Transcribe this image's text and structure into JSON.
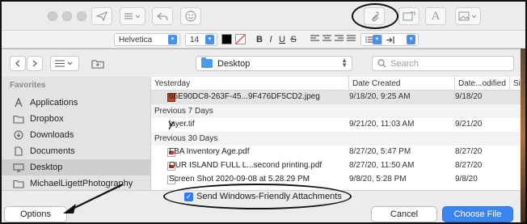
{
  "compose_toolbar": {
    "icons": [
      "send-icon",
      "list-dropdown-icon",
      "reply-icon",
      "emoji-icon",
      "attachment-paperclip-icon",
      "header-fields-icon",
      "format-text-icon",
      "photo-browser-icon"
    ],
    "format_label": "A"
  },
  "format_bar": {
    "font_family": "Helvetica",
    "font_size": "14",
    "bold": "B",
    "italic": "I",
    "underline": "U",
    "strike": "S",
    "text_color": "#000000"
  },
  "dialog": {
    "location": "Desktop",
    "search_placeholder": "Search"
  },
  "sidebar": {
    "heading": "Favorites",
    "items": [
      {
        "label": "Applications",
        "icon": "applications-icon"
      },
      {
        "label": "Dropbox",
        "icon": "dropbox-folder-icon"
      },
      {
        "label": "Downloads",
        "icon": "downloads-icon"
      },
      {
        "label": "Documents",
        "icon": "documents-icon"
      },
      {
        "label": "Desktop",
        "icon": "desktop-icon",
        "selected": true
      },
      {
        "label": "MichaelLigettPhotography",
        "icon": "folder-icon"
      }
    ]
  },
  "filelist": {
    "columns": {
      "name": "Yesterday",
      "created": "Date Created",
      "modified": "Date...odified",
      "size": "Siz"
    },
    "groups": [
      {
        "label": "Yesterday",
        "rows": [
          {
            "name": "66E90DC8-263F-45...9F476DF5CD2.jpeg",
            "created": "9/18/20, 9:25 AM",
            "modified": "9/18/20",
            "type": "jpg",
            "selected": true
          }
        ]
      },
      {
        "label": "Previous 7 Days",
        "rows": [
          {
            "name": "layer.tif",
            "created": "9/21/20, 11:03 AM",
            "modified": "9/21/20",
            "type": "tif"
          }
        ]
      },
      {
        "label": "Previous 30 Days",
        "rows": [
          {
            "name": "FBA Inventory Age.pdf",
            "created": "8/27/20, 5:47 PM",
            "modified": "8/27/20",
            "type": "pdf"
          },
          {
            "name": "OUR ISLAND FULL L...second printing.pdf",
            "created": "8/27/20, 11:50 AM",
            "modified": "8/27/20",
            "type": "pdf"
          },
          {
            "name": "Screen Shot 2020-09-08 at 5.28.29 PM",
            "created": "9/8/20, 5:28 PM",
            "modified": "9/8/20",
            "type": "png"
          }
        ]
      }
    ]
  },
  "bottom": {
    "windows_friendly_label": "Send Windows-Friendly Attachments",
    "windows_friendly_checked": true,
    "options_label": "Options",
    "cancel_label": "Cancel",
    "choose_label": "Choose File"
  }
}
